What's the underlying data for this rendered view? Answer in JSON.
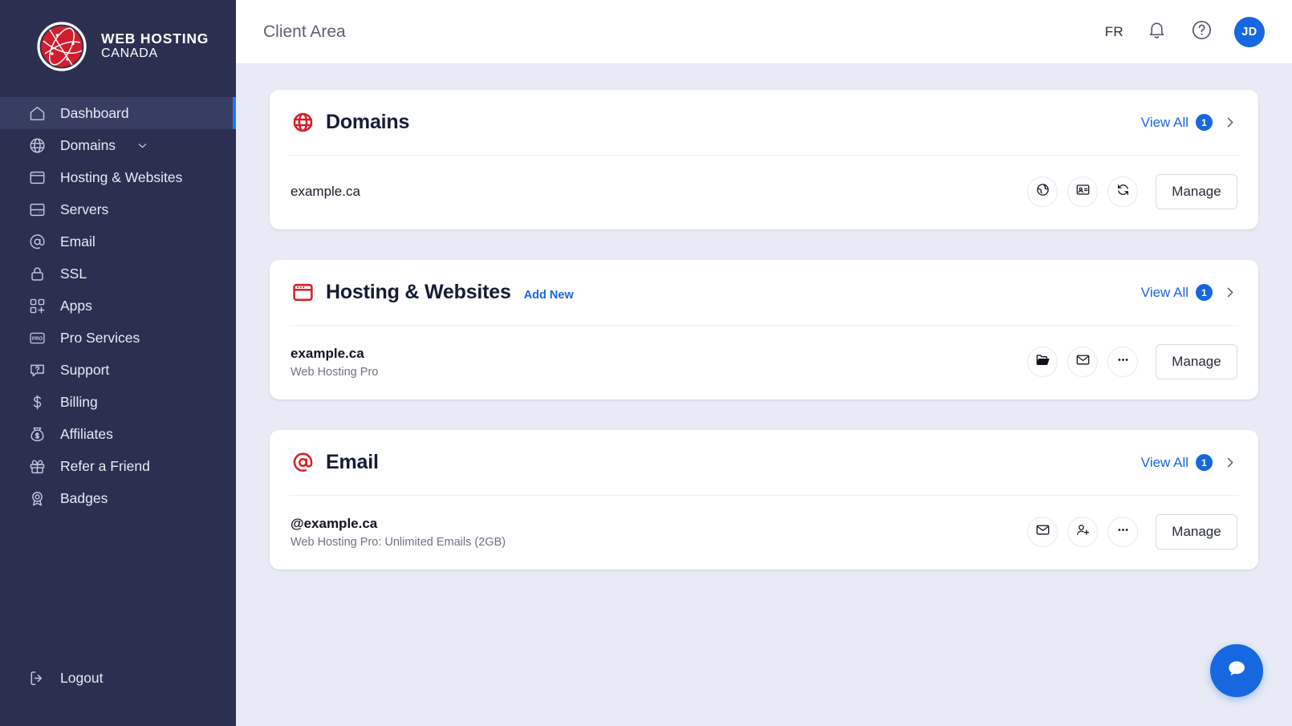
{
  "brand": {
    "line1": "WEB HOSTING",
    "line2": "CANADA",
    "logo_icon": "globe-logo-icon",
    "logo_color": "#cf1f2e"
  },
  "sidebar": {
    "items": [
      {
        "label": "Dashboard",
        "icon": "home-icon",
        "active": true,
        "has_chevron": false
      },
      {
        "label": "Domains",
        "icon": "globe-icon",
        "active": false,
        "has_chevron": true
      },
      {
        "label": "Hosting & Websites",
        "icon": "browser-icon",
        "active": false,
        "has_chevron": false
      },
      {
        "label": "Servers",
        "icon": "server-icon",
        "active": false,
        "has_chevron": false
      },
      {
        "label": "Email",
        "icon": "at-sign-icon",
        "active": false,
        "has_chevron": false
      },
      {
        "label": "SSL",
        "icon": "lock-icon",
        "active": false,
        "has_chevron": false
      },
      {
        "label": "Apps",
        "icon": "apps-grid-icon",
        "active": false,
        "has_chevron": false
      },
      {
        "label": "Pro Services",
        "icon": "pro-badge-icon",
        "active": false,
        "has_chevron": false
      },
      {
        "label": "Support",
        "icon": "help-chat-icon",
        "active": false,
        "has_chevron": false
      },
      {
        "label": "Billing",
        "icon": "dollar-icon",
        "active": false,
        "has_chevron": false
      },
      {
        "label": "Affiliates",
        "icon": "money-bag-icon",
        "active": false,
        "has_chevron": false
      },
      {
        "label": "Refer a Friend",
        "icon": "gift-icon",
        "active": false,
        "has_chevron": false
      },
      {
        "label": "Badges",
        "icon": "award-medal-icon",
        "active": false,
        "has_chevron": false
      }
    ],
    "logout": {
      "label": "Logout",
      "icon": "logout-icon"
    },
    "active_indicator_color": "#1d7afc",
    "background_color": "#2b3050"
  },
  "header": {
    "title": "Client Area",
    "language": "FR",
    "notifications_icon": "bell-icon",
    "help_icon": "question-circle-icon",
    "avatar_initials": "JD",
    "avatar_color": "#1767e0"
  },
  "cards": [
    {
      "id": "domains",
      "title": "Domains",
      "icon": "globe-icon",
      "icon_color": "#d81f2a",
      "add_new": null,
      "view_all_label": "View All",
      "view_all_count": "1",
      "rows": [
        {
          "title": "example.ca",
          "title_bold": false,
          "subtitle": null,
          "actions": [
            {
              "icon": "globe-dns-icon"
            },
            {
              "icon": "contact-card-icon"
            },
            {
              "icon": "refresh-renew-icon"
            }
          ],
          "manage_label": "Manage"
        }
      ]
    },
    {
      "id": "hosting",
      "title": "Hosting & Websites",
      "icon": "browser-window-icon",
      "icon_color": "#d81f2a",
      "add_new": "Add New",
      "view_all_label": "View All",
      "view_all_count": "1",
      "rows": [
        {
          "title": "example.ca",
          "title_bold": true,
          "subtitle": "Web Hosting Pro",
          "actions": [
            {
              "icon": "folder-open-icon"
            },
            {
              "icon": "envelope-icon"
            },
            {
              "icon": "ellipsis-icon"
            }
          ],
          "manage_label": "Manage"
        }
      ]
    },
    {
      "id": "email",
      "title": "Email",
      "icon": "at-sign-icon",
      "icon_color": "#d81f2a",
      "add_new": null,
      "view_all_label": "View All",
      "view_all_count": "1",
      "rows": [
        {
          "title": "@example.ca",
          "title_bold": true,
          "subtitle": "Web Hosting Pro: Unlimited Emails (2GB)",
          "actions": [
            {
              "icon": "envelope-icon"
            },
            {
              "icon": "user-add-icon"
            },
            {
              "icon": "ellipsis-icon"
            }
          ],
          "manage_label": "Manage"
        }
      ]
    }
  ],
  "fab": {
    "icon": "chat-bubble-icon",
    "color": "#1767e0"
  }
}
